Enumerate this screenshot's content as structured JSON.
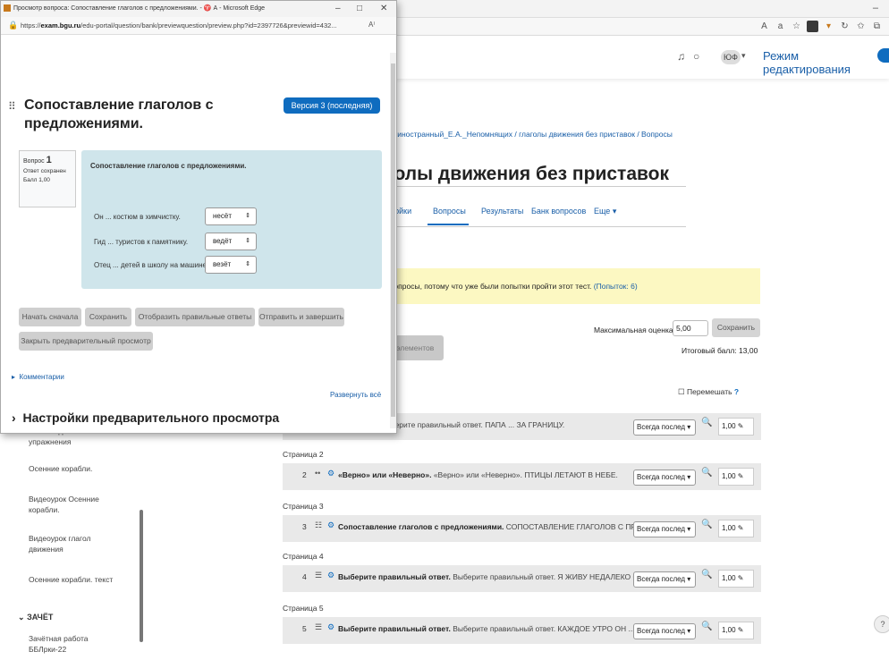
{
  "background": {
    "edit_mode_label": "Режим редактирования",
    "avatar_initials": "ЮФ",
    "breadcrumb": "ык иностранный_Е.А._Непомнящих / глаголы движения без приставок / Вопросы",
    "page_title": "голы движения без приставок",
    "nav_tabs": [
      "тройки",
      "Вопросы",
      "Результаты",
      "Банк вопросов",
      "Еще ▾"
    ],
    "warning_text": "вопросы, потому что уже были попытки пройти этот тест.",
    "warning_link": "(Попыток: 6)",
    "max_grade_label": "Максимальная оценка",
    "max_grade_value": "5,00",
    "save_label": "Сохранить",
    "select_all_label": "о элементов",
    "total_grade": "Итоговый балл: 13,00",
    "shuffle_label": "Перемешать",
    "left_items": [
      "глаголы движения. упражнения",
      "Осенние корабли.",
      "Видеоурок Осенние корабли.",
      "Видеоурок глагол движения",
      "Осенние корабли. текст"
    ],
    "section_title": "ЗАЧЁТ",
    "section_item": "Зачётная работа ББЛрки-22",
    "slots": [
      {
        "page": "",
        "num": "",
        "icon": "••",
        "type": "ный ответ.",
        "text": "Выберите правильный ответ. ПАПА ... ЗА ГРАНИЦУ.",
        "select": "Всегда послед ▾",
        "mark": "1,00"
      },
      {
        "page": "Страница 2",
        "num": "2",
        "icon": "••",
        "type": "«Верно» или «Неверно».",
        "text": "«Верно» или «Неверно». ПТИЦЫ ЛЕТАЮТ В НЕБЕ.",
        "select": "Всегда послед ▾",
        "mark": "1,00"
      },
      {
        "page": "Страница 3",
        "num": "3",
        "icon": "☷",
        "type": "Сопоставление глаголов с предложениями.",
        "text": "СОПОСТАВЛЕНИЕ ГЛАГОЛОВ С ПРЕДЛО...",
        "select": "Всегда послед ▾",
        "mark": "1,00"
      },
      {
        "page": "Страница 4",
        "num": "4",
        "icon": "☰",
        "type": "Выберите правильный ответ.",
        "text": "Выберите правильный ответ. Я ЖИВУ НЕДАЛЕКО ОТ ...",
        "select": "Всегда послед ▾",
        "mark": "1,00"
      },
      {
        "page": "Страница 5",
        "num": "5",
        "icon": "☰",
        "type": "Выберите правильный ответ.",
        "text": "Выберите правильный ответ. КАЖДОЕ УТРО ОН ....",
        "select": "Всегда послед ▾",
        "mark": "1,00"
      }
    ],
    "help_label": "?"
  },
  "popup": {
    "window_title": "Просмотр вопроса: Сопоставление глаголов с предложениями. - ♈ А - Microsoft Edge",
    "url_prefix": "https://",
    "url_domain": "exam.bgu.ru",
    "url_rest": "/edu-portal/question/bank/previewquestion/preview.php?id=2397726&previewid=432...",
    "question_heading": "Сопоставление глаголов с предложениями.",
    "version_badge": "Версия 3 (последняя)",
    "info_label": "Вопрос",
    "info_num": "1",
    "info_status": "Ответ сохранен",
    "info_grade": "Балл 1,00",
    "question_text": "Сопоставление глаголов с предложениями.",
    "rows": [
      {
        "text": "Он ... костюм в химчистку.",
        "value": "несёт"
      },
      {
        "text": "Гид ... туристов к памятнику.",
        "value": "ведёт"
      },
      {
        "text": "Отец ... детей в школу на машине.",
        "value": "везёт"
      }
    ],
    "buttons": [
      "Начать сначала",
      "Сохранить",
      "Отобразить правильные ответы",
      "Отправить и завершить"
    ],
    "close_preview": "Закрыть предварительный просмотр",
    "comments": "Комментарии",
    "expand_all": "Развернуть всё",
    "settings_heading": "Настройки предварительного просмотра"
  }
}
